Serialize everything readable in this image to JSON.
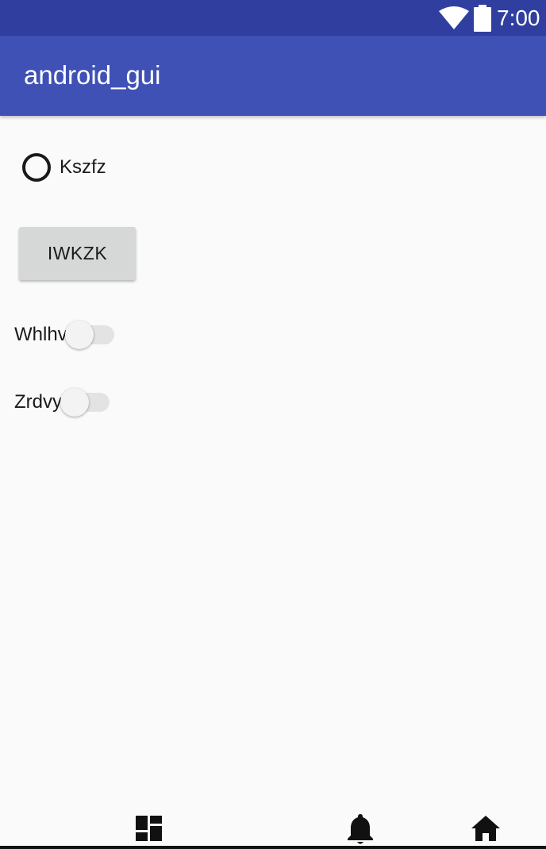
{
  "status_bar": {
    "time": "7:00",
    "icons": [
      "wifi-icon",
      "battery-icon"
    ]
  },
  "app_bar": {
    "title": "android_gui"
  },
  "content": {
    "radio": {
      "label": "Kszfz",
      "checked": false
    },
    "button": {
      "label": "IWKZK"
    },
    "switches": [
      {
        "label": "Whlhv",
        "on": false
      },
      {
        "label": "Zrdvy",
        "on": false
      }
    ]
  },
  "nav_bar": {
    "icons": [
      "dashboard-icon",
      "bell-icon",
      "home-icon"
    ]
  },
  "colors": {
    "status_bar": "#303f9f",
    "app_bar": "#3f51b5",
    "background": "#fafafa",
    "button": "#d6d7d7"
  }
}
